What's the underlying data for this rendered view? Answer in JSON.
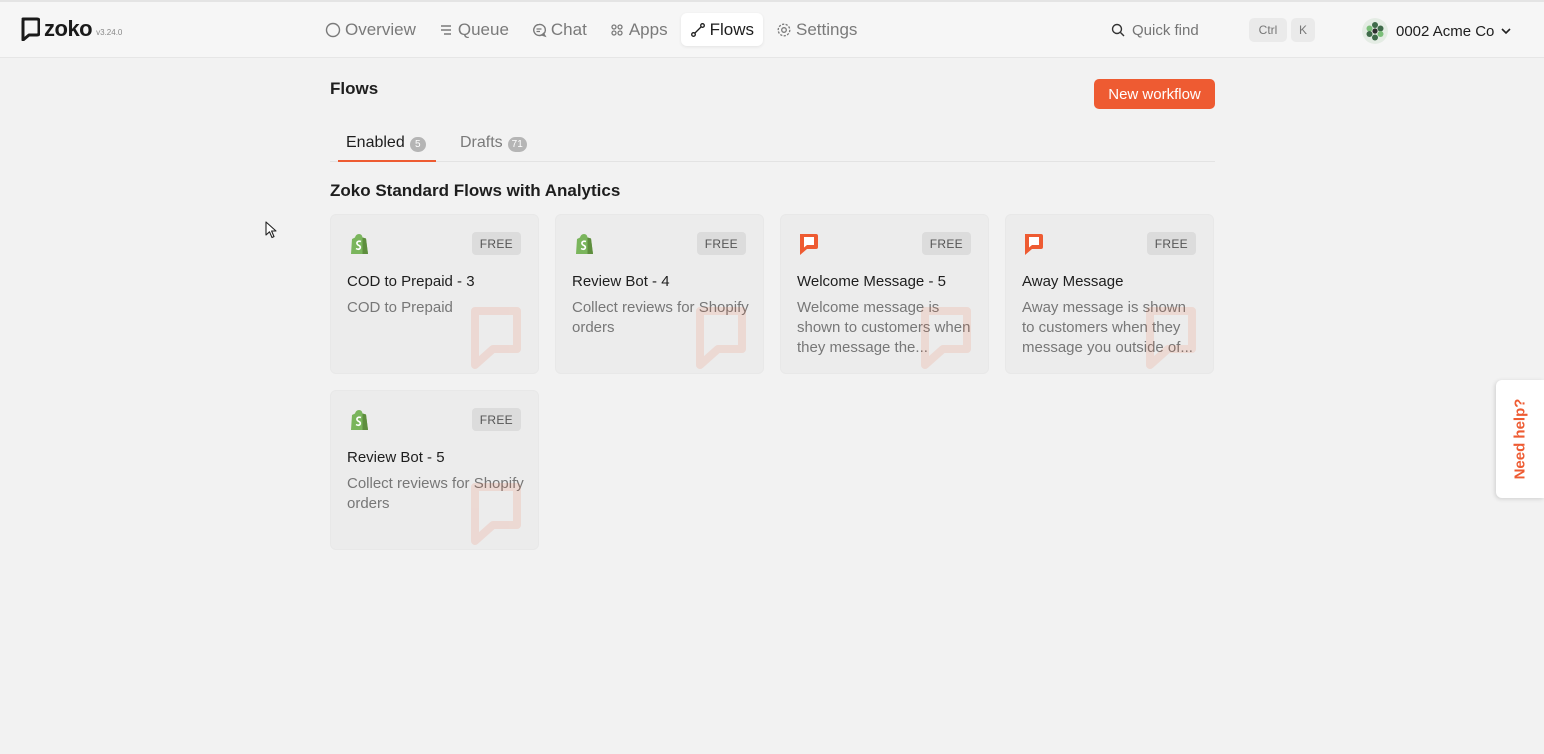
{
  "header": {
    "logo_text": "zoko",
    "version": "v3.24.0",
    "nav": [
      {
        "label": "Overview",
        "icon": "circle-icon"
      },
      {
        "label": "Queue",
        "icon": "list-icon"
      },
      {
        "label": "Chat",
        "icon": "chat-icon"
      },
      {
        "label": "Apps",
        "icon": "grid-icon"
      },
      {
        "label": "Flows",
        "icon": "flow-icon",
        "active": true
      },
      {
        "label": "Settings",
        "icon": "gear-icon"
      }
    ],
    "quick_find": {
      "placeholder": "Quick find",
      "shortcut_modifier": "Ctrl",
      "shortcut_key": "K"
    },
    "account": {
      "name": "0002 Acme Co"
    }
  },
  "page": {
    "title": "Flows",
    "new_button": "New workflow",
    "tabs": [
      {
        "label": "Enabled",
        "count": "5",
        "active": true
      },
      {
        "label": "Drafts",
        "count": "71",
        "active": false
      }
    ],
    "section_title": "Zoko Standard Flows with Analytics"
  },
  "cards": [
    {
      "title": "COD to Prepaid - 3",
      "desc": "COD to Prepaid",
      "badge": "FREE",
      "icon": "shopify-icon"
    },
    {
      "title": "Review Bot - 4",
      "desc": "Collect reviews for Shopify orders",
      "badge": "FREE",
      "icon": "shopify-icon"
    },
    {
      "title": "Welcome Message - 5",
      "desc": "Welcome message is shown to customers when they message the...",
      "badge": "FREE",
      "icon": "zoko-icon"
    },
    {
      "title": "Away Message",
      "desc": "Away message is shown to customers when they message you outside of...",
      "badge": "FREE",
      "icon": "zoko-icon"
    },
    {
      "title": "Review Bot - 5",
      "desc": "Collect reviews for Shopify orders",
      "badge": "FREE",
      "icon": "shopify-icon"
    }
  ],
  "help": {
    "label": "Need help?"
  },
  "colors": {
    "accent": "#ee5b32",
    "shopify": "#7ab55c",
    "background": "#f2f2f2"
  }
}
